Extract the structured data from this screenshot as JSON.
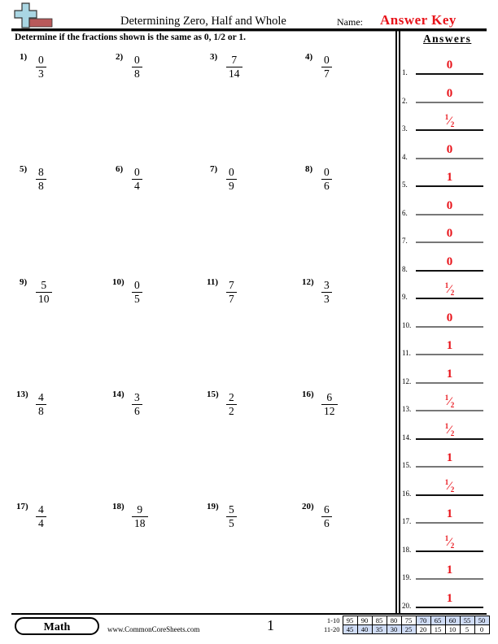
{
  "header": {
    "logo_icon": "plus-ruler-logo-icon",
    "title": "Determining Zero, Half and Whole",
    "name_label": "Name:",
    "answer_key": "Answer Key"
  },
  "instructions": "Determine if the fractions shown is the same as 0, 1/2 or 1.",
  "problems": [
    {
      "label": "1)",
      "numerator": "0",
      "denominator": "3"
    },
    {
      "label": "2)",
      "numerator": "0",
      "denominator": "8"
    },
    {
      "label": "3)",
      "numerator": "7",
      "denominator": "14"
    },
    {
      "label": "4)",
      "numerator": "0",
      "denominator": "7"
    },
    {
      "label": "5)",
      "numerator": "8",
      "denominator": "8"
    },
    {
      "label": "6)",
      "numerator": "0",
      "denominator": "4"
    },
    {
      "label": "7)",
      "numerator": "0",
      "denominator": "9"
    },
    {
      "label": "8)",
      "numerator": "0",
      "denominator": "6"
    },
    {
      "label": "9)",
      "numerator": "5",
      "denominator": "10"
    },
    {
      "label": "10)",
      "numerator": "0",
      "denominator": "5"
    },
    {
      "label": "11)",
      "numerator": "7",
      "denominator": "7"
    },
    {
      "label": "12)",
      "numerator": "3",
      "denominator": "3"
    },
    {
      "label": "13)",
      "numerator": "4",
      "denominator": "8"
    },
    {
      "label": "14)",
      "numerator": "3",
      "denominator": "6"
    },
    {
      "label": "15)",
      "numerator": "2",
      "denominator": "2"
    },
    {
      "label": "16)",
      "numerator": "6",
      "denominator": "12"
    },
    {
      "label": "17)",
      "numerator": "4",
      "denominator": "4"
    },
    {
      "label": "18)",
      "numerator": "9",
      "denominator": "18"
    },
    {
      "label": "19)",
      "numerator": "5",
      "denominator": "5"
    },
    {
      "label": "20)",
      "numerator": "6",
      "denominator": "6"
    }
  ],
  "answers": {
    "title": "Answers",
    "items": [
      {
        "label": "1.",
        "value": "0"
      },
      {
        "label": "2.",
        "value": "0"
      },
      {
        "label": "3.",
        "value": "1/2"
      },
      {
        "label": "4.",
        "value": "0"
      },
      {
        "label": "5.",
        "value": "1"
      },
      {
        "label": "6.",
        "value": "0"
      },
      {
        "label": "7.",
        "value": "0"
      },
      {
        "label": "8.",
        "value": "0"
      },
      {
        "label": "9.",
        "value": "1/2"
      },
      {
        "label": "10.",
        "value": "0"
      },
      {
        "label": "11.",
        "value": "1"
      },
      {
        "label": "12.",
        "value": "1"
      },
      {
        "label": "13.",
        "value": "1/2"
      },
      {
        "label": "14.",
        "value": "1/2"
      },
      {
        "label": "15.",
        "value": "1"
      },
      {
        "label": "16.",
        "value": "1/2"
      },
      {
        "label": "17.",
        "value": "1"
      },
      {
        "label": "18.",
        "value": "1/2"
      },
      {
        "label": "19.",
        "value": "1"
      },
      {
        "label": "20.",
        "value": "1"
      }
    ]
  },
  "footer": {
    "subject": "Math",
    "website": "www.CommonCoreSheets.com",
    "page_number": "1",
    "score_table": [
      {
        "label": "1-10",
        "scores": [
          "95",
          "90",
          "85",
          "80",
          "75",
          "70",
          "65",
          "60",
          "55",
          "50"
        ]
      },
      {
        "label": "11-20",
        "scores": [
          "45",
          "40",
          "35",
          "30",
          "25",
          "20",
          "15",
          "10",
          "5",
          "0"
        ]
      }
    ],
    "highlight_color": "#cfdcf6"
  },
  "colors": {
    "answer_red": "#e8131a"
  }
}
